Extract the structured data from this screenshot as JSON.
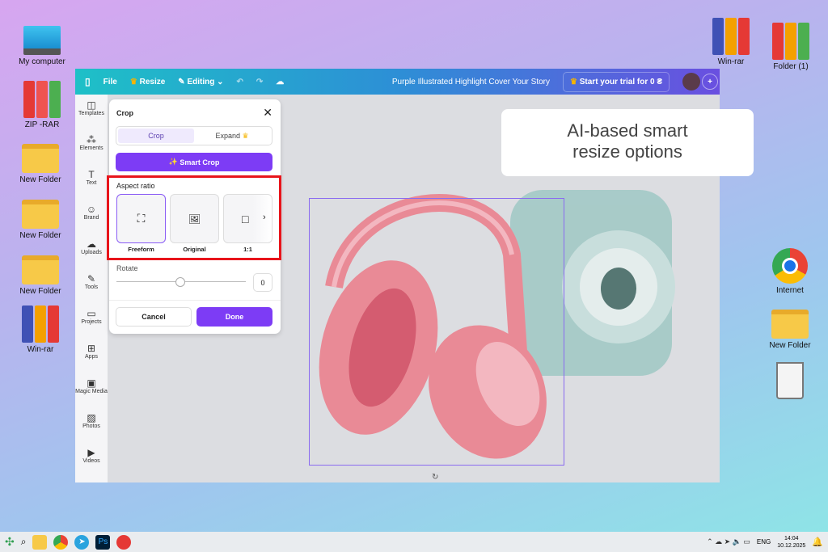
{
  "desktop": {
    "left": [
      "My computer",
      "ZIP -RAR",
      "New Folder",
      "New Folder",
      "New Folder",
      "Win-rar"
    ],
    "right": [
      "Win-rar",
      "Folder (1)",
      "Internet",
      "New Folder"
    ]
  },
  "topbar": {
    "file": "File",
    "resize": "Resize",
    "editing": "Editing",
    "title": "Purple Illustrated Highlight Cover Your Story",
    "trial": "Start your trial for 0 ₴"
  },
  "sidebar": [
    "Templates",
    "Elements",
    "Text",
    "Brand",
    "Uploads",
    "Tools",
    "Projects",
    "Apps",
    "Magic Media",
    "Photos",
    "Videos"
  ],
  "crop_panel": {
    "title": "Crop",
    "tabs": [
      "Crop",
      "Expand"
    ],
    "smart_crop": "Smart Crop",
    "aspect_label": "Aspect ratio",
    "ratios": [
      "Freeform",
      "Original",
      "1:1"
    ],
    "rotate_label": "Rotate",
    "rotate_value": "0",
    "cancel": "Cancel",
    "done": "Done"
  },
  "callout": {
    "line1": "AI-based smart",
    "line2": "resize options"
  },
  "taskbar": {
    "lang": "ENG",
    "time": "14:04",
    "date": "10.12.2025"
  },
  "colors": {
    "accent": "#7d3cf5",
    "highlight": "#e8141b"
  }
}
